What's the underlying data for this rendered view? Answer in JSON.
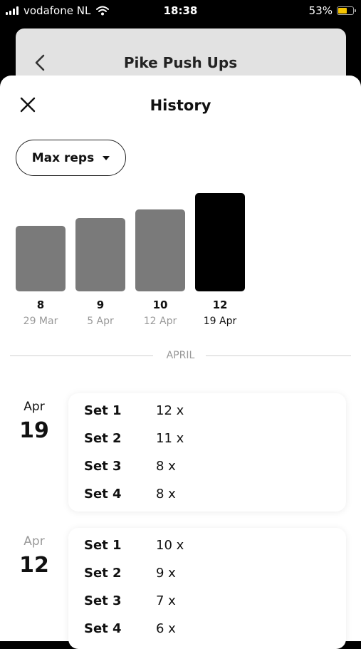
{
  "status_bar": {
    "carrier": "vodafone NL",
    "time": "18:38",
    "battery": "53%",
    "battery_level": 0.53,
    "battery_color": "#f5c400"
  },
  "background_screen": {
    "title": "Pike Push Ups"
  },
  "sheet": {
    "title": "History",
    "metric_selector": {
      "label": "Max reps",
      "icon": "chevron-down-icon"
    }
  },
  "chart_data": {
    "type": "bar",
    "categories": [
      "29 Mar",
      "5 Apr",
      "12 Apr",
      "19 Apr"
    ],
    "values": [
      8,
      9,
      10,
      12
    ],
    "value_labels": [
      "8",
      "9",
      "10",
      "12"
    ],
    "selected_index": 3,
    "colors": {
      "default": "#7a7a7a",
      "selected": "#000000"
    }
  },
  "month_separator": "APRIL",
  "sessions": [
    {
      "month": "Apr",
      "day": "19",
      "sets": [
        {
          "label": "Set 1",
          "reps": "12 x"
        },
        {
          "label": "Set 2",
          "reps": "11 x"
        },
        {
          "label": "Set 3",
          "reps": "8 x"
        },
        {
          "label": "Set 4",
          "reps": "8 x"
        }
      ]
    },
    {
      "month": "Apr",
      "day": "12",
      "sets": [
        {
          "label": "Set 1",
          "reps": "10 x"
        },
        {
          "label": "Set 2",
          "reps": "9 x"
        },
        {
          "label": "Set 3",
          "reps": "7 x"
        },
        {
          "label": "Set 4",
          "reps": "6 x"
        }
      ]
    }
  ]
}
